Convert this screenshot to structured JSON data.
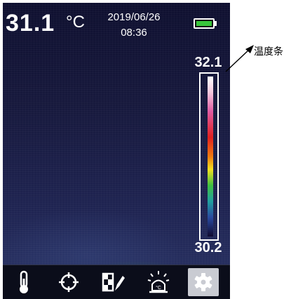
{
  "status_bar": {
    "temperature": "31.1",
    "unit": "°C",
    "date": "2019/06/26",
    "time": "08:36",
    "battery_icon": "battery-full-icon"
  },
  "scale": {
    "max": "32.1",
    "min": "30.2"
  },
  "callout": {
    "label": "温度条"
  },
  "toolbar": {
    "items": [
      {
        "icon": "thermometer-icon"
      },
      {
        "icon": "crosshair-icon"
      },
      {
        "icon": "palette-icon"
      },
      {
        "icon": "alarm-temperature-icon"
      },
      {
        "icon": "gear-icon"
      }
    ]
  },
  "colors": {
    "battery_fill": "#38c43a",
    "active_tool_bg": "#c9cbd2"
  }
}
